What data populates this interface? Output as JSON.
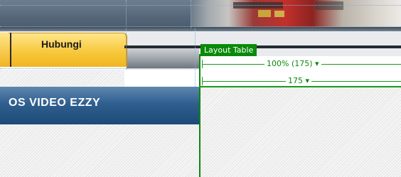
{
  "nav": {
    "tab_label": "Hubungi"
  },
  "section": {
    "heading": "OS VIDEO EZZY"
  },
  "layout_table": {
    "badge": "Layout Table",
    "width_outer": "100% (175) ▾",
    "width_inner": "175 ▾"
  },
  "colors": {
    "tab_yellow": "#f7c83a",
    "heading_blue": "#2f5f8f",
    "layout_green": "#0a8a0a"
  }
}
